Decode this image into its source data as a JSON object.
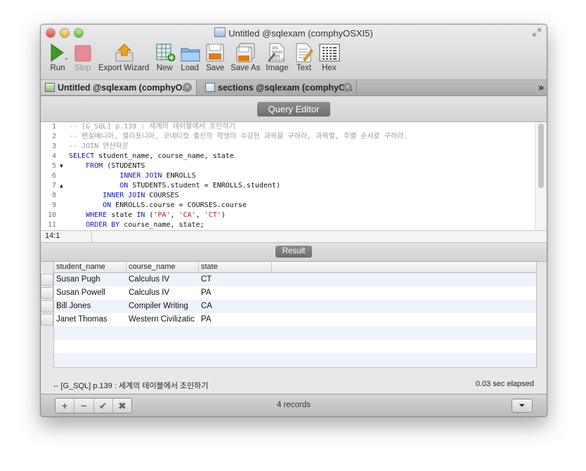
{
  "window": {
    "title": "Untitled @sqlexam (comphyOSXI5)"
  },
  "toolbar": {
    "buttons": [
      {
        "label": "Run",
        "icon": "run-icon",
        "enabled": true
      },
      {
        "label": "Stop",
        "icon": "stop-icon",
        "enabled": false
      },
      {
        "label": "Export Wizard",
        "icon": "export-wizard-icon",
        "enabled": true
      },
      {
        "label": "New",
        "icon": "new-icon",
        "enabled": true
      },
      {
        "label": "Load",
        "icon": "load-icon",
        "enabled": true
      },
      {
        "label": "Save",
        "icon": "save-icon",
        "enabled": true
      },
      {
        "label": "Save As",
        "icon": "save-as-icon",
        "enabled": true
      },
      {
        "label": "Image",
        "icon": "image-icon",
        "enabled": true
      },
      {
        "label": "Text",
        "icon": "text-icon",
        "enabled": true
      },
      {
        "label": "Hex",
        "icon": "hex-icon",
        "enabled": true
      }
    ]
  },
  "tabs": [
    {
      "label": "Untitled @sqlexam (comphyO...",
      "active": true
    },
    {
      "label": "sections @sqlexam (comphyO...",
      "active": false
    }
  ],
  "query_editor": {
    "header": "Query Editor",
    "cursor_position": "14:1",
    "lines": [
      {
        "n": "1",
        "fold": "",
        "parts": [
          {
            "t": "-- [G_SQL] p.139 : 세계의 테이블에서 조인하기",
            "c": "cmt"
          }
        ]
      },
      {
        "n": "2",
        "fold": "",
        "parts": [
          {
            "t": "-- 펜실베니아, 캘리포니아, 코네티컷 출신의 학생이 수강한 과목을 구하라, 과목별, 주별 순서로 구하라.",
            "c": "cmt"
          }
        ]
      },
      {
        "n": "3",
        "fold": "",
        "parts": [
          {
            "t": "-- JOIN 연산자문",
            "c": "cmt"
          }
        ]
      },
      {
        "n": "4",
        "fold": "",
        "parts": [
          {
            "t": "SELECT",
            "c": "kw"
          },
          {
            "t": " student_name, course_name, state",
            "c": ""
          }
        ]
      },
      {
        "n": "5",
        "fold": "▼",
        "parts": [
          {
            "t": "    FROM",
            "c": "kw"
          },
          {
            "t": " (STUDENTS",
            "c": ""
          }
        ]
      },
      {
        "n": "6",
        "fold": "",
        "parts": [
          {
            "t": "            INNER JOIN",
            "c": "kw"
          },
          {
            "t": " ENROLLS",
            "c": ""
          }
        ]
      },
      {
        "n": "7",
        "fold": "▲",
        "parts": [
          {
            "t": "            ON",
            "c": "kw"
          },
          {
            "t": " STUDENTS.student = ENROLLS.student)",
            "c": ""
          }
        ]
      },
      {
        "n": "8",
        "fold": "",
        "parts": [
          {
            "t": "        INNER JOIN",
            "c": "kw"
          },
          {
            "t": " COURSES",
            "c": ""
          }
        ]
      },
      {
        "n": "9",
        "fold": "",
        "parts": [
          {
            "t": "        ON",
            "c": "kw"
          },
          {
            "t": " ENROLLS.course = COURSES.course",
            "c": ""
          }
        ]
      },
      {
        "n": "10",
        "fold": "",
        "parts": [
          {
            "t": "    WHERE",
            "c": "kw"
          },
          {
            "t": " state ",
            "c": ""
          },
          {
            "t": "IN",
            "c": "kw"
          },
          {
            "t": " (",
            "c": ""
          },
          {
            "t": "'PA'",
            "c": "str"
          },
          {
            "t": ", ",
            "c": ""
          },
          {
            "t": "'CA'",
            "c": "str"
          },
          {
            "t": ", ",
            "c": ""
          },
          {
            "t": "'CT'",
            "c": "str"
          },
          {
            "t": ")",
            "c": ""
          }
        ]
      },
      {
        "n": "11",
        "fold": "",
        "parts": [
          {
            "t": "    ORDER BY",
            "c": "kw"
          },
          {
            "t": " course_name, state;",
            "c": ""
          }
        ]
      }
    ]
  },
  "result": {
    "header": "Result",
    "columns": [
      "student_name",
      "course_name",
      "state"
    ],
    "rows": [
      [
        "Susan Pugh",
        "Calculus IV",
        "CT"
      ],
      [
        "Susan Powell",
        "Calculus IV",
        "PA"
      ],
      [
        "Bill Jones",
        "Compiler Writing",
        "CA"
      ],
      [
        "Janet Thomas",
        "Western Civilizatic",
        "PA"
      ]
    ]
  },
  "footer": {
    "message": "-- [G_SQL] p.139 : 세계의 테이블에서 조인하기",
    "elapsed": "0.03 sec elapsed",
    "records": "4 records"
  }
}
